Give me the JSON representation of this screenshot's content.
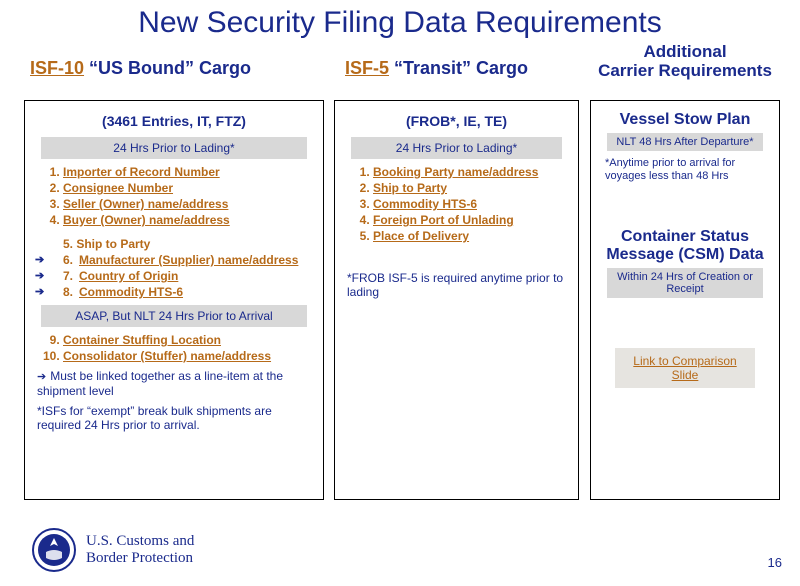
{
  "title": "New Security Filing Data Requirements",
  "columns": {
    "c1": {
      "link": "ISF-10",
      "rest": " “US Bound” Cargo"
    },
    "c2": {
      "link": "ISF-5",
      "rest": " “Transit” Cargo"
    },
    "c3_line1": "Additional",
    "c3_line2": "Carrier Requirements"
  },
  "box1": {
    "subtitle": "(3461 Entries, IT, FTZ)",
    "bar1": "24 Hrs Prior to Lading*",
    "items_a": [
      "Importer of Record Number",
      "Consignee Number",
      "Seller (Owner) name/address",
      "Buyer (Owner) name/address"
    ],
    "items_b": [
      {
        "n": "5.",
        "t": "Ship to Party",
        "arrow": false,
        "ul": false
      },
      {
        "n": "6.",
        "t": "Manufacturer (Supplier) name/address",
        "arrow": true,
        "ul": true
      },
      {
        "n": "7.",
        "t": "Country of Origin",
        "arrow": true,
        "ul": true
      },
      {
        "n": "8.",
        "t": "Commodity HTS-6",
        "arrow": true,
        "ul": true
      }
    ],
    "bar2": "ASAP, But NLT 24 Hrs Prior to Arrival",
    "items_c_start": 9,
    "items_c": [
      "Container Stuffing Location",
      "Consolidator (Stuffer) name/address"
    ],
    "note1_arrow": "➔",
    "note1": "Must be linked together as a line-item at the shipment level",
    "note2": "*ISFs for “exempt” break bulk shipments are required 24 Hrs prior to arrival."
  },
  "box2": {
    "subtitle": "(FROB*, IE, TE)",
    "bar1": "24 Hrs Prior to Lading*",
    "items": [
      "Booking Party name/address",
      "Ship to Party",
      "Commodity HTS-6",
      "Foreign Port of Unlading",
      "Place of Delivery"
    ],
    "note": "*FROB ISF-5 is required anytime prior to lading"
  },
  "box3": {
    "vsp_title": "Vessel Stow Plan",
    "vsp_bar": "NLT 48 Hrs After Departure*",
    "vsp_note": "*Anytime prior to arrival for voyages less than 48 Hrs",
    "csm_title_l1": "Container Status",
    "csm_title_l2": "Message (CSM) Data",
    "csm_bar": "Within 24 Hrs of Creation or Receipt",
    "link_label": "Link to Comparison Slide"
  },
  "footer": {
    "org_l1": "U.S. Customs and",
    "org_l2": "Border Protection",
    "page": "16"
  }
}
